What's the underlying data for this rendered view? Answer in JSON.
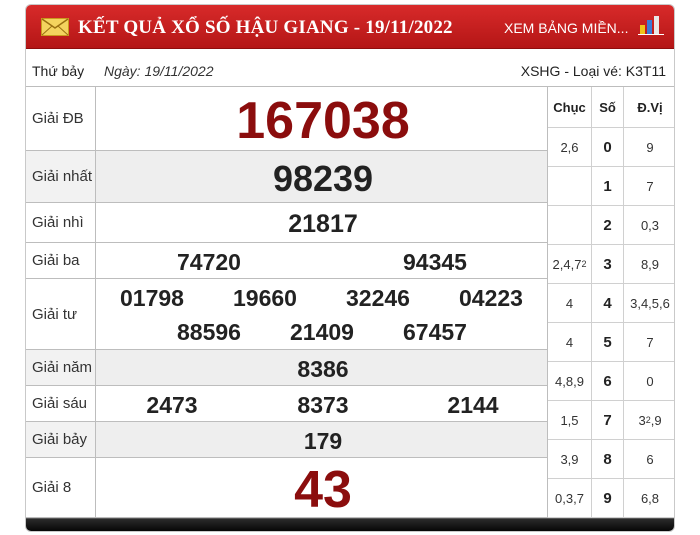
{
  "header": {
    "title": "KẾT QUẢ XỔ SỐ HẬU GIANG - 19/11/2022",
    "view_link": "XEM BẢNG MIỀN...",
    "icons": [
      "mail-icon",
      "bar-chart-icon"
    ]
  },
  "info": {
    "weekday": "Thứ bảy",
    "date": "Ngày: 19/11/2022",
    "code": "XSHG - Loại vé: K3T11"
  },
  "prizes": [
    {
      "label": "Giải ĐB",
      "numbers": [
        "167038"
      ]
    },
    {
      "label": "Giải nhất",
      "numbers": [
        "98239"
      ]
    },
    {
      "label": "Giải nhì",
      "numbers": [
        "21817"
      ]
    },
    {
      "label": "Giải ba",
      "numbers": [
        "74720",
        "94345"
      ]
    },
    {
      "label": "Giải tư",
      "numbers": [
        "01798",
        "19660",
        "32246",
        "04223",
        "88596",
        "21409",
        "67457"
      ]
    },
    {
      "label": "Giải năm",
      "numbers": [
        "8386"
      ]
    },
    {
      "label": "Giải sáu",
      "numbers": [
        "2473",
        "8373",
        "2144"
      ]
    },
    {
      "label": "Giải bảy",
      "numbers": [
        "179"
      ]
    },
    {
      "label": "Giải 8",
      "numbers": [
        "43"
      ]
    }
  ],
  "loto": {
    "headers": [
      "Chục",
      "Số",
      "Đ.Vị"
    ],
    "rows": [
      {
        "chuc": "2,6",
        "so": "0",
        "dvi": "9"
      },
      {
        "chuc": "",
        "so": "1",
        "dvi": "7"
      },
      {
        "chuc": "",
        "so": "2",
        "dvi": "0,3"
      },
      {
        "chuc": "2,4,7",
        "chuc_sup": "2",
        "so": "3",
        "dvi": "8,9"
      },
      {
        "chuc": "4",
        "so": "4",
        "dvi": "3,4,5,6"
      },
      {
        "chuc": "4",
        "so": "5",
        "dvi": "7"
      },
      {
        "chuc": "4,8,9",
        "so": "6",
        "dvi": "0"
      },
      {
        "chuc": "1,5",
        "so": "7",
        "dvi": "3",
        "dvi_sup": "2",
        "dvi_rest": ",9"
      },
      {
        "chuc": "3,9",
        "so": "8",
        "dvi": "6"
      },
      {
        "chuc": "0,3,7",
        "so": "9",
        "dvi": "6,8"
      }
    ]
  }
}
